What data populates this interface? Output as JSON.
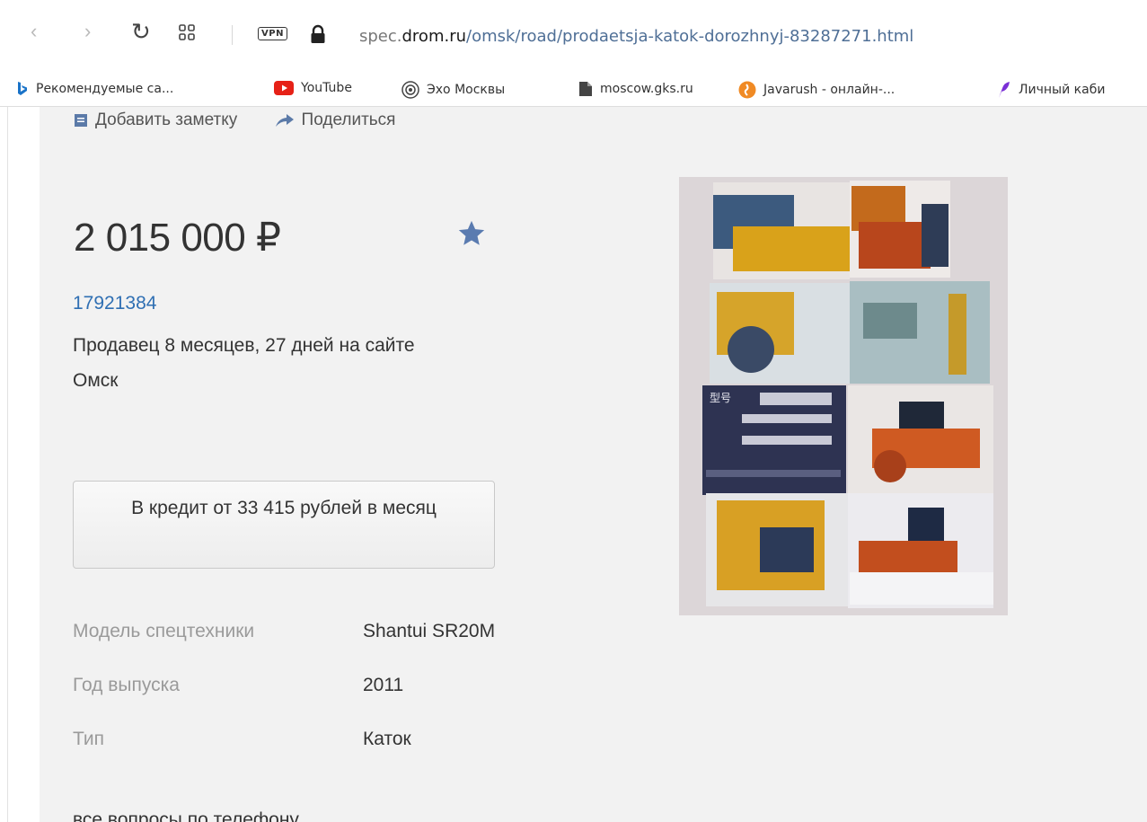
{
  "browser": {
    "url_prefix": "spec.",
    "url_host": "drom.ru",
    "url_path": "/omsk/road/prodaetsja-katok-dorozhnyj-83287271.html",
    "vpn_label": "VPN",
    "bookmarks": [
      {
        "label": "Рекомендуемые са...",
        "icon": "bing-icon"
      },
      {
        "label": "YouTube",
        "icon": "youtube-icon"
      },
      {
        "label": "Эхо Москвы",
        "icon": "echo-icon"
      },
      {
        "label": "moscow.gks.ru",
        "icon": "document-icon"
      },
      {
        "label": "Javarush - онлайн-...",
        "icon": "javarush-icon"
      },
      {
        "label": "Личный каби",
        "icon": "feather-icon"
      }
    ]
  },
  "listing": {
    "actions": {
      "note_label": "Добавить заметку",
      "share_label": "Поделиться"
    },
    "price": "2 015 000 ₽",
    "seller_id": "17921384",
    "seller_since": "Продавец 8 месяцев, 27 дней на сайте",
    "city": "Омск",
    "credit_button": "В кредит от 33 415 рублей в месяц",
    "specs": [
      {
        "label": "Модель спецтехники",
        "value": "Shantui SR20M"
      },
      {
        "label": "Год выпуска",
        "value": "2011"
      },
      {
        "label": "Тип",
        "value": "Каток"
      }
    ],
    "cut_text": "все вопросы по телефону",
    "photo_plate": "型号"
  },
  "colors": {
    "link": "#2f6fb3",
    "star": "#5a7bb0",
    "page_bg": "#f2f2f2"
  }
}
